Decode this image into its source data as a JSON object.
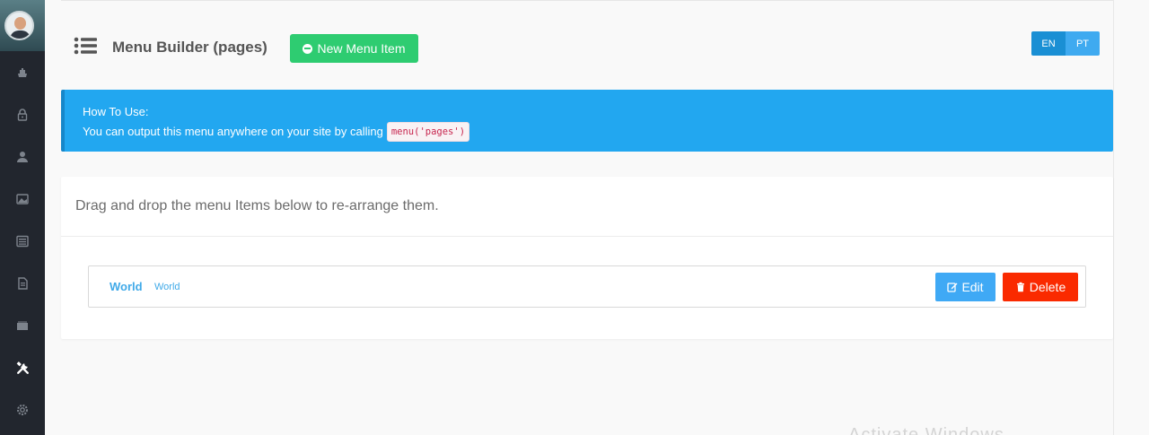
{
  "header": {
    "title": "Menu Builder (pages)",
    "new_item_label": "New Menu Item"
  },
  "languages": [
    {
      "code": "EN",
      "active": true
    },
    {
      "code": "PT",
      "active": false
    }
  ],
  "alert": {
    "title": "How To Use:",
    "text": "You can output this menu anywhere on your site by calling",
    "code": "menu('pages')"
  },
  "panel": {
    "heading": "Drag and drop the menu Items below to re-arrange them."
  },
  "menu_items": [
    {
      "title": "World",
      "subtitle": "World",
      "edit_label": "Edit",
      "delete_label": "Delete"
    }
  ],
  "watermark": "Activate Windows",
  "sidebar": {
    "icons": [
      "boat-icon",
      "lock-icon",
      "user-icon",
      "images-icon",
      "news-icon",
      "document-icon",
      "folder-icon",
      "tools-icon",
      "gear-icon"
    ]
  },
  "colors": {
    "sidebar": "#22262e",
    "success": "#2ecc71",
    "info": "#22a7f0",
    "primary": "#1a8fd4",
    "danger": "#fa2a00",
    "link": "#3fa9e8"
  }
}
